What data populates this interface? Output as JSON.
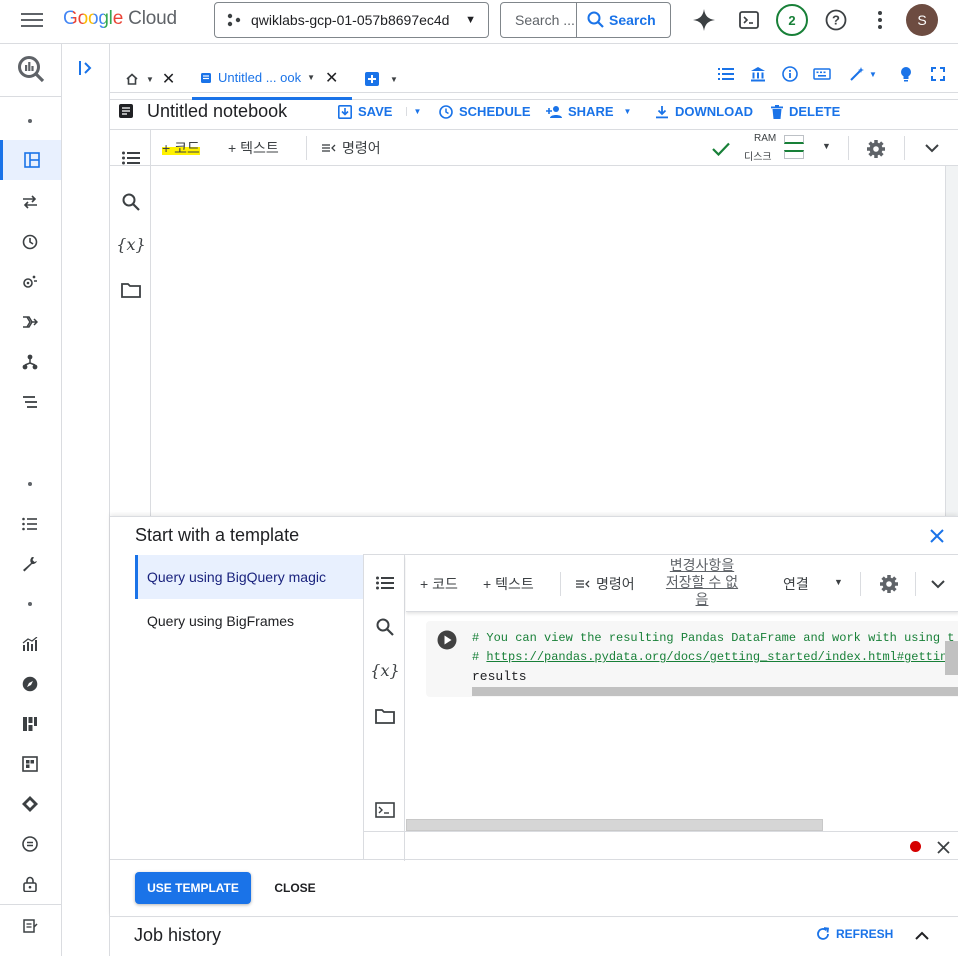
{
  "topbar": {
    "logo_google": "Google",
    "logo_cloud": "Cloud",
    "project": "qwiklabs-gcp-01-057b8697ec4d",
    "search_placeholder": "Search ...",
    "search_button": "Search",
    "notif_count": "2",
    "avatar_letter": "S"
  },
  "tabs": {
    "notebook_tab": "Untitled ... ook"
  },
  "notebook": {
    "title": "Untitled notebook",
    "save": "SAVE",
    "schedule": "SCHEDULE",
    "share": "SHARE",
    "download": "DOWNLOAD",
    "delete": "DELETE"
  },
  "colab": {
    "add_code": "+ 코드",
    "add_text": "+ 텍스트",
    "command": "명령어",
    "ram_label": "RAM",
    "disk_label": "디스크"
  },
  "template": {
    "title": "Start with a template",
    "items": [
      "Query using BigQuery magic",
      "Query using BigFrames"
    ],
    "preview_add_code": "+ 코드",
    "preview_add_text": "+ 텍스트",
    "preview_command": "명령어",
    "unsaved_line1": "변경사항을",
    "unsaved_line2": "저장할 수 없",
    "unsaved_line3": "음",
    "connect": "연결",
    "code_line1": "# You can view the resulting Pandas DataFrame and work with using t",
    "code_line2_prefix": "# ",
    "code_line2_link": "https://pandas.pydata.org/docs/getting_started/index.html#getting-",
    "code_line3": "results",
    "use_template": "USE TEMPLATE",
    "close": "CLOSE"
  },
  "jobhistory": {
    "title": "Job history",
    "refresh": "REFRESH"
  },
  "colors": {
    "accent": "#1a73e8",
    "google_blue": "#4285f4",
    "google_red": "#ea4335",
    "google_yellow": "#fbbc04",
    "google_green": "#34a853",
    "highlight": "#fff200",
    "check_green": "#188038",
    "record_red": "#d93025",
    "avatar_bg": "#6d4c41"
  }
}
